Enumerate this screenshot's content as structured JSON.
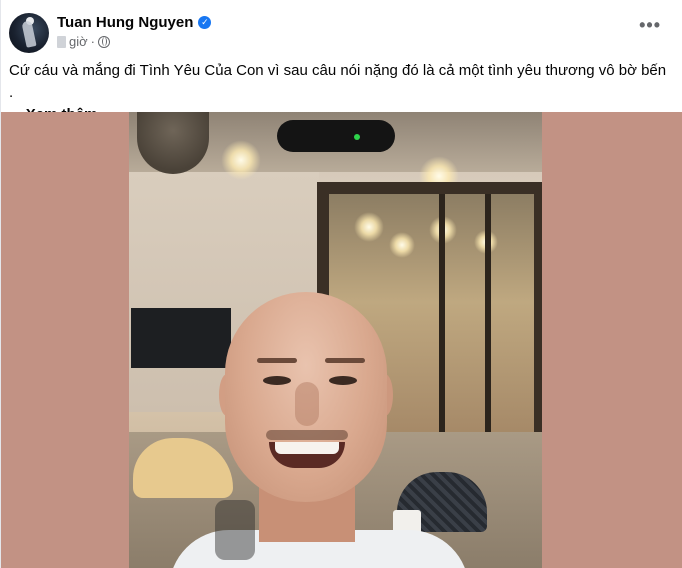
{
  "post": {
    "author_name": "Tuan Hung Nguyen",
    "verified_icon": "verified-badge-icon",
    "time_label": "giờ",
    "separator": "·",
    "audience_icon": "globe-icon",
    "more_icon": "•••",
    "caption_text": "Cứ cáu và mắng đi Tình Yêu  Của Con vì sau câu nói nặng đó là cả một tình yêu thương vô bờ bến .",
    "ellipsis": "...",
    "see_more_label": "Xem thêm"
  },
  "colors": {
    "media_background": "#c29284",
    "verified_blue": "#1877f2",
    "secondary_text": "#65676b"
  }
}
